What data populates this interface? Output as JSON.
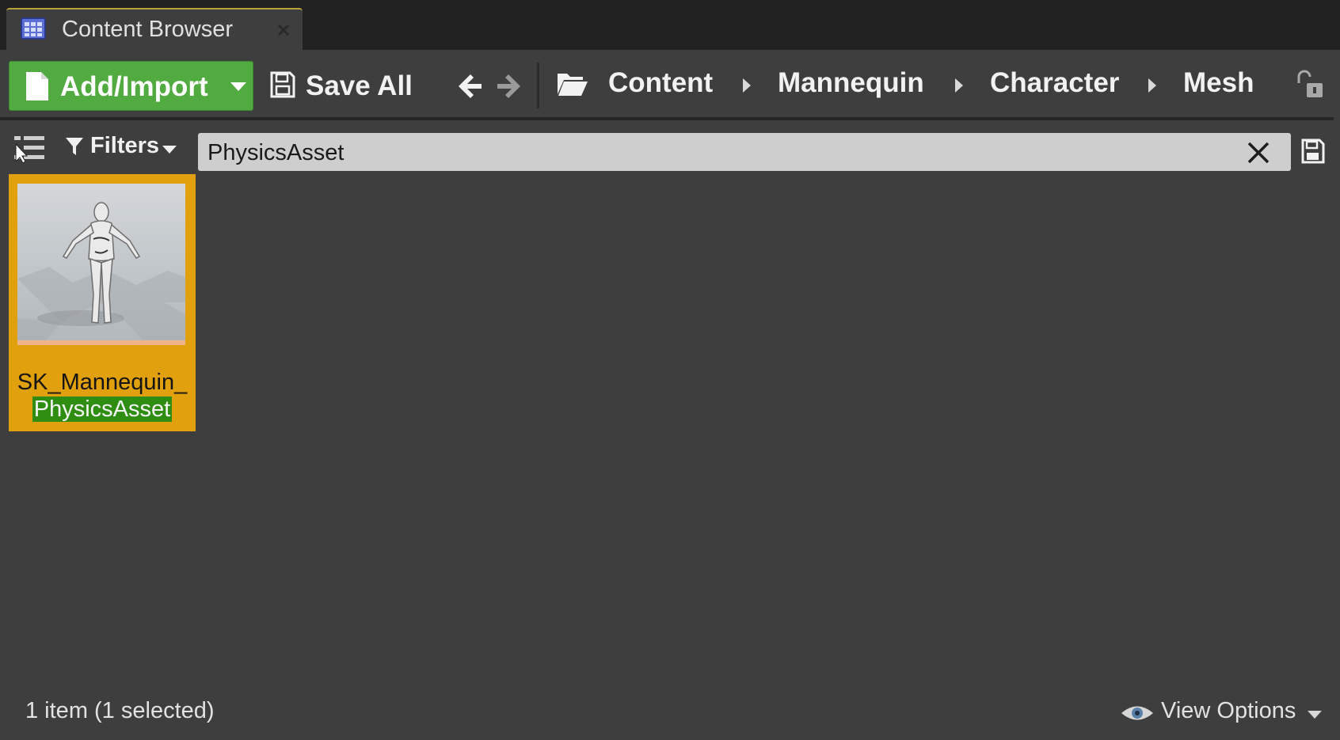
{
  "tab": {
    "title": "Content Browser",
    "icon": "content-browser-icon"
  },
  "toolbar": {
    "add_import_label": "Add/Import",
    "save_all_label": "Save All",
    "breadcrumb": [
      "Content",
      "Mannequin",
      "Character",
      "Mesh"
    ]
  },
  "filter_bar": {
    "filters_label": "Filters",
    "search_value": "PhysicsAsset"
  },
  "assets": [
    {
      "name_prefix": "SK_Mannequin_",
      "name_match": "PhysicsAsset",
      "selected": true
    }
  ],
  "status": {
    "item_count": "1 item (1 selected)",
    "view_options_label": "View Options"
  },
  "colors": {
    "add_import": "#52ab40",
    "selection": "#e1a10e",
    "search_highlight": "#2f8d12"
  }
}
